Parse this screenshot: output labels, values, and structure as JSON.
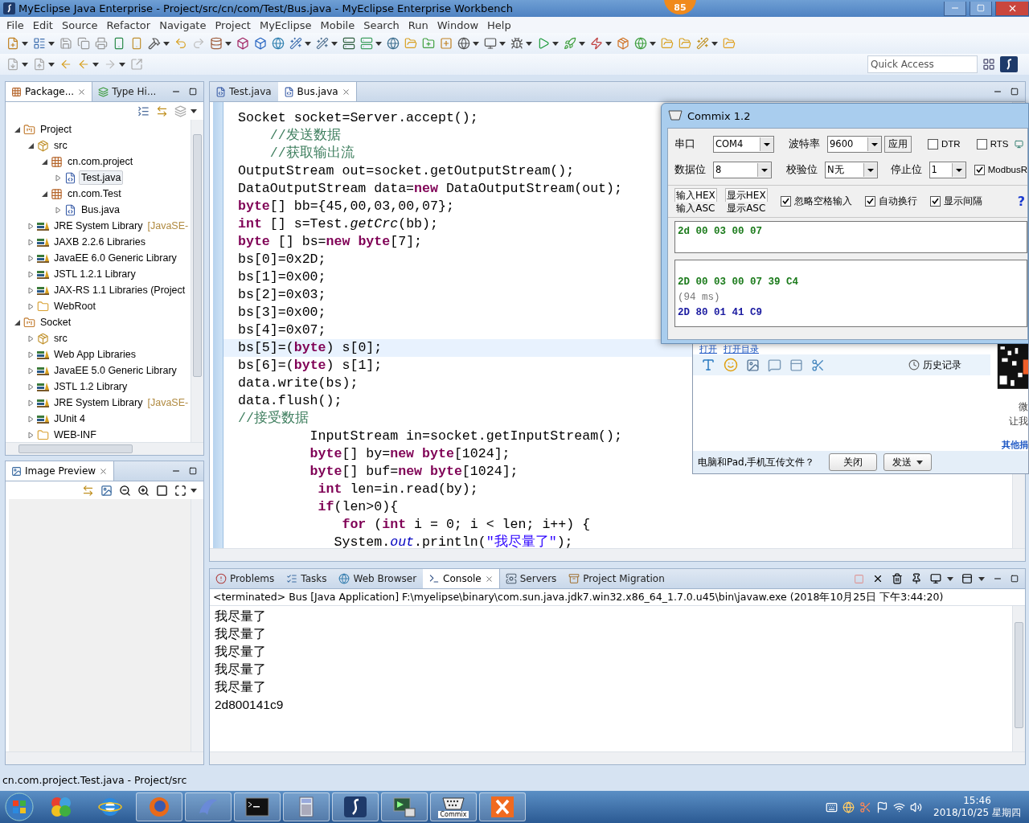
{
  "window": {
    "title": "MyEclipse Java Enterprise - Project/src/cn/com/Test/Bus.java - MyEclipse Enterprise Workbench",
    "badge": "85"
  },
  "menu": [
    "File",
    "Edit",
    "Source",
    "Refactor",
    "Navigate",
    "Project",
    "MyEclipse",
    "Mobile",
    "Search",
    "Run",
    "Window",
    "Help"
  ],
  "quick_access": {
    "placeholder": "Quick Access"
  },
  "package_explorer": {
    "tabs": [
      {
        "label": "Package...",
        "selected": true
      },
      {
        "label": "Type Hi...",
        "selected": false
      }
    ],
    "tree": [
      {
        "label": "Project",
        "kind": "project",
        "expanded": true,
        "selected": false,
        "children": [
          {
            "label": "src",
            "kind": "srcfolder",
            "expanded": true,
            "selected": false,
            "children": [
              {
                "label": "cn.com.project",
                "kind": "package",
                "expanded": true,
                "selected": false,
                "children": [
                  {
                    "label": "Test.java",
                    "kind": "javafile",
                    "expanded": false,
                    "selected": true
                  }
                ]
              },
              {
                "label": "cn.com.Test",
                "kind": "package",
                "expanded": true,
                "selected": false,
                "children": [
                  {
                    "label": "Bus.java",
                    "kind": "javafile",
                    "expanded": false,
                    "selected": false
                  }
                ]
              }
            ]
          },
          {
            "label": "JRE System Library",
            "decoration": "[JavaSE-",
            "kind": "library",
            "expanded": false,
            "selected": false
          },
          {
            "label": "JAXB 2.2.6 Libraries",
            "kind": "library",
            "expanded": false,
            "selected": false
          },
          {
            "label": "JavaEE 6.0 Generic Library",
            "kind": "library",
            "expanded": false,
            "selected": false
          },
          {
            "label": "JSTL 1.2.1 Library",
            "kind": "library",
            "expanded": false,
            "selected": false
          },
          {
            "label": "JAX-RS 1.1 Libraries (Project",
            "kind": "library",
            "expanded": false,
            "selected": false
          },
          {
            "label": "WebRoot",
            "kind": "folder",
            "expanded": false,
            "selected": false
          }
        ]
      },
      {
        "label": "Socket",
        "kind": "project",
        "expanded": true,
        "selected": false,
        "children": [
          {
            "label": "src",
            "kind": "srcfolder",
            "expanded": false,
            "selected": false
          },
          {
            "label": "Web App Libraries",
            "kind": "library",
            "expanded": false,
            "selected": false
          },
          {
            "label": "JavaEE 5.0 Generic Library",
            "kind": "library",
            "expanded": false,
            "selected": false
          },
          {
            "label": "JSTL 1.2 Library",
            "kind": "library",
            "expanded": false,
            "selected": false
          },
          {
            "label": "JRE System Library",
            "decoration": "[JavaSE-",
            "kind": "library",
            "expanded": false,
            "selected": false
          },
          {
            "label": "JUnit 4",
            "kind": "library",
            "expanded": false,
            "selected": false
          },
          {
            "label": "WEB-INF",
            "kind": "folder",
            "expanded": false,
            "selected": false
          }
        ]
      }
    ]
  },
  "image_preview": {
    "tabs": [
      {
        "label": "Image Preview",
        "selected": true
      }
    ]
  },
  "editor": {
    "tabs": [
      {
        "label": "Test.java",
        "selected": false
      },
      {
        "label": "Bus.java",
        "selected": true
      }
    ],
    "lines": [
      {
        "current": false,
        "tokens": [
          {
            "kind": "code",
            "text": "Socket socket=Server.accept();"
          }
        ]
      },
      {
        "current": false,
        "tokens": [
          {
            "kind": "comment",
            "text": "    //发送数据"
          }
        ]
      },
      {
        "current": false,
        "tokens": [
          {
            "kind": "comment",
            "text": "    //获取输出流"
          }
        ]
      },
      {
        "current": false,
        "tokens": [
          {
            "kind": "code",
            "text": "OutputStream out=socket.getOutputStream();"
          }
        ]
      },
      {
        "current": false,
        "tokens": [
          {
            "kind": "code",
            "text": "DataOutputStream data="
          },
          {
            "kind": "keyword",
            "text": "new"
          },
          {
            "kind": "code",
            "text": " DataOutputStream(out);"
          }
        ]
      },
      {
        "current": false,
        "tokens": [
          {
            "kind": "keyword",
            "text": "byte"
          },
          {
            "kind": "code",
            "text": "[] bb={45,00,03,00,07};"
          }
        ]
      },
      {
        "current": false,
        "tokens": [
          {
            "kind": "keyword",
            "text": "int"
          },
          {
            "kind": "code",
            "text": " [] s=Test."
          },
          {
            "kind": "italic",
            "text": "getCrc"
          },
          {
            "kind": "code",
            "text": "(bb);"
          }
        ]
      },
      {
        "current": false,
        "tokens": [
          {
            "kind": "keyword",
            "text": "byte"
          },
          {
            "kind": "code",
            "text": " [] bs="
          },
          {
            "kind": "keyword",
            "text": "new byte"
          },
          {
            "kind": "code",
            "text": "[7];"
          }
        ]
      },
      {
        "current": false,
        "tokens": [
          {
            "kind": "code",
            "text": "bs[0]=0x2D;"
          }
        ]
      },
      {
        "current": false,
        "tokens": [
          {
            "kind": "code",
            "text": "bs[1]=0x00;"
          }
        ]
      },
      {
        "current": false,
        "tokens": [
          {
            "kind": "code",
            "text": "bs[2]=0x03;"
          }
        ]
      },
      {
        "current": false,
        "tokens": [
          {
            "kind": "code",
            "text": "bs[3]=0x00;"
          }
        ]
      },
      {
        "current": false,
        "tokens": [
          {
            "kind": "code",
            "text": "bs[4]=0x07;"
          }
        ]
      },
      {
        "current": true,
        "tokens": [
          {
            "kind": "code",
            "text": "bs[5]=("
          },
          {
            "kind": "keyword",
            "text": "byte"
          },
          {
            "kind": "code",
            "text": ") s[0];"
          }
        ]
      },
      {
        "current": false,
        "tokens": [
          {
            "kind": "code",
            "text": "bs[6]=("
          },
          {
            "kind": "keyword",
            "text": "byte"
          },
          {
            "kind": "code",
            "text": ") s[1];"
          }
        ]
      },
      {
        "current": false,
        "tokens": [
          {
            "kind": "code",
            "text": "data.write(bs);"
          }
        ]
      },
      {
        "current": false,
        "tokens": [
          {
            "kind": "code",
            "text": "data.flush();"
          }
        ]
      },
      {
        "current": false,
        "tokens": [
          {
            "kind": "comment",
            "text": "//接受数据"
          }
        ]
      },
      {
        "current": false,
        "tokens": [
          {
            "kind": "code",
            "text": "         InputStream in=socket.getInputStream();"
          }
        ]
      },
      {
        "current": false,
        "tokens": [
          {
            "kind": "keyword",
            "text": "         byte"
          },
          {
            "kind": "code",
            "text": "[] by="
          },
          {
            "kind": "keyword",
            "text": "new byte"
          },
          {
            "kind": "code",
            "text": "[1024];"
          }
        ]
      },
      {
        "current": false,
        "tokens": [
          {
            "kind": "keyword",
            "text": "         byte"
          },
          {
            "kind": "code",
            "text": "[] buf="
          },
          {
            "kind": "keyword",
            "text": "new byte"
          },
          {
            "kind": "code",
            "text": "[1024];"
          }
        ]
      },
      {
        "current": false,
        "tokens": [
          {
            "kind": "keyword",
            "text": "          int"
          },
          {
            "kind": "code",
            "text": " len=in.read(by);"
          }
        ]
      },
      {
        "current": false,
        "tokens": [
          {
            "kind": "keyword",
            "text": "          if"
          },
          {
            "kind": "code",
            "text": "(len>0){"
          }
        ]
      },
      {
        "current": false,
        "tokens": [
          {
            "kind": "keyword",
            "text": "             for"
          },
          {
            "kind": "code",
            "text": " ("
          },
          {
            "kind": "keyword",
            "text": "int"
          },
          {
            "kind": "code",
            "text": " i = 0; i < len; i++) {"
          }
        ]
      },
      {
        "current": false,
        "tokens": [
          {
            "kind": "code",
            "text": "            System."
          },
          {
            "kind": "field",
            "text": "out"
          },
          {
            "kind": "code",
            "text": ".println("
          },
          {
            "kind": "string",
            "text": "\"我尽量了\""
          },
          {
            "kind": "code",
            "text": ");"
          }
        ]
      }
    ]
  },
  "commix": {
    "title": "Commix 1.2",
    "port": {
      "label": "串口",
      "value": "COM4"
    },
    "baud": {
      "label": "波特率",
      "value": "9600"
    },
    "apply": "应用",
    "dtr": {
      "label": "DTR",
      "checked": false
    },
    "rts": {
      "label": "RTS",
      "checked": false
    },
    "data_bits": {
      "label": "数据位",
      "value": "8"
    },
    "parity": {
      "label": "校验位",
      "value": "N无"
    },
    "stop_bits": {
      "label": "停止位",
      "value": "1"
    },
    "modbus": {
      "label": "ModbusR",
      "checked": true
    },
    "modes": [
      {
        "top": "输入HEX",
        "bottom": "输入ASC"
      },
      {
        "top": "显示HEX",
        "bottom": "显示ASC"
      }
    ],
    "options": [
      {
        "label": "忽略空格输入",
        "checked": true
      },
      {
        "label": "自动换行",
        "checked": true
      },
      {
        "label": "显示间隔",
        "checked": true
      }
    ],
    "help": "?",
    "send_text": "2d 00 03 00 07",
    "receive": [
      {
        "kind": "sent",
        "text": "2D 00 03 00 07 39 C4"
      },
      {
        "kind": "time",
        "text": "(94 ms)"
      },
      {
        "kind": "received",
        "text": "2D 80 01 41 C9"
      }
    ]
  },
  "chat": {
    "links": [
      "打开",
      "打开目录"
    ],
    "history": "历史记录",
    "qr_caption": [
      "微",
      "让我"
    ],
    "donate_link": "其他捐",
    "footer": "电脑和Pad,手机互传文件？",
    "buttons": [
      "关闭",
      "发送"
    ]
  },
  "console": {
    "tabs": [
      {
        "label": "Problems",
        "kind": "problems",
        "selected": false
      },
      {
        "label": "Tasks",
        "kind": "tasks",
        "selected": false
      },
      {
        "label": "Web Browser",
        "kind": "browser",
        "selected": false
      },
      {
        "label": "Console",
        "kind": "console",
        "selected": true
      },
      {
        "label": "Servers",
        "kind": "servers",
        "selected": false
      },
      {
        "label": "Project Migration",
        "kind": "migration",
        "selected": false
      }
    ],
    "header": "<terminated> Bus [Java Application] F:\\myelipse\\binary\\com.sun.java.jdk7.win32.x86_64_1.7.0.u45\\bin\\javaw.exe (2018年10月25日 下午3:44:20)",
    "output": [
      "我尽量了",
      "我尽量了",
      "我尽量了",
      "我尽量了",
      "我尽量了",
      "2d800141c9"
    ]
  },
  "status_bar": "cn.com.project.Test.java - Project/src",
  "taskbar": {
    "apps": [
      {
        "kind": "balls",
        "open": false
      },
      {
        "kind": "ie",
        "open": false
      },
      {
        "kind": "firefox",
        "open": true
      },
      {
        "kind": "dolphin",
        "open": true
      },
      {
        "kind": "terminal",
        "open": true
      },
      {
        "kind": "calculator",
        "open": true
      },
      {
        "kind": "eclipse",
        "open": true
      },
      {
        "kind": "monitor",
        "open": true
      },
      {
        "kind": "serial",
        "open": true,
        "label": "Commix"
      },
      {
        "kind": "tools",
        "open": true
      }
    ],
    "time": "15:46",
    "date": "2018/10/25 星期四"
  }
}
